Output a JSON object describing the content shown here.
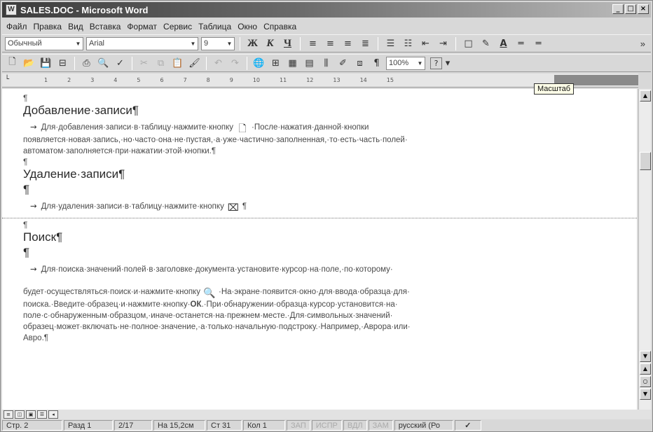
{
  "window": {
    "title": "SALES.DOC - Microsoft Word",
    "controls": [
      "_",
      "□",
      "×"
    ]
  },
  "menu": [
    "Файл",
    "Правка",
    "Вид",
    "Вставка",
    "Формат",
    "Сервис",
    "Таблица",
    "Окно",
    "Справка"
  ],
  "format_toolbar": {
    "style": "Обычный",
    "font": "Arial",
    "size": "9",
    "bold": "Ж",
    "italic": "К",
    "underline": "Ч"
  },
  "standard_toolbar": {
    "zoom": "100%",
    "help": "?"
  },
  "ruler": {
    "marks": [
      "1",
      "2",
      "3",
      "4",
      "5",
      "6",
      "7",
      "8",
      "9",
      "10",
      "11",
      "12",
      "13",
      "14",
      "15"
    ]
  },
  "tooltip": "Масштаб",
  "document": {
    "pilcrow": "¶",
    "tab_arrow": "→",
    "sections": {
      "add": {
        "heading": "Добавление·записи¶",
        "text_before": "Для·добавления·записи·в·таблицу·нажмите·кнопку",
        "text_after": "·После·нажатия·данной·кнопки",
        "line2": "появляется·новая·запись,·но·часто·она·не·пустая,·а·уже·частично·заполненная,·то·есть·часть·полей·",
        "line3": "автоматом·заполняется·при·нажатии·этой·кнопки.¶"
      },
      "delete": {
        "heading": "Удаление·записи¶",
        "text_before": "Для·удаления·записи·в·таблицу·нажмите·кнопку",
        "text_after": "¶"
      },
      "search": {
        "heading": "Поиск¶",
        "line1": "Для·поиска·значений·полей·в·заголовке·документа·установите·курсор·на·поле,·по·которому·",
        "line2_before": "будет·осуществляться·поиск·и·нажмите·кнопку",
        "line2_after": "·На·экране·появится·окно·для·ввода·образца·для·",
        "line3_before": "поиска.·Введите·образец·и·нажмите·кнопку·",
        "line3_ok": "ОК",
        "line3_after": ".·При·обнаружении·образца·курсор·установится·на·",
        "line4": "поле·с·обнаруженным·образцом,·иначе·останется·на·прежнем·месте.·Для·символьных·значений·",
        "line5": "образец·может·включать·не·полное·значение,·а·только·начальную·подстроку.·Например,·Аврора·или·",
        "line6": "Авро.¶"
      }
    }
  },
  "status": {
    "page": "Стр. 2",
    "section": "Разд 1",
    "pages": "2/17",
    "at": "На 15,2см",
    "line": "Ст 31",
    "col": "Кол 1",
    "rec": "ЗАП",
    "trk": "ИСПР",
    "ext": "ВДЛ",
    "ovr": "ЗАМ",
    "lang": "русский (Ро"
  }
}
